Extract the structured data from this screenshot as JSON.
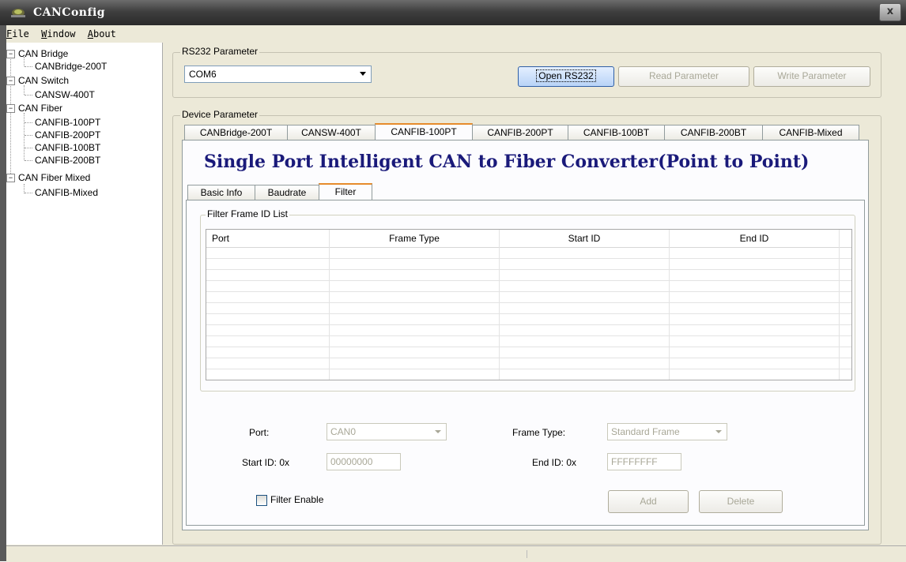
{
  "window": {
    "title": "CANConfig",
    "close_label": "x"
  },
  "menu": [
    {
      "label": "File",
      "accel": "F",
      "rest": "ile"
    },
    {
      "label": "Window",
      "accel": "W",
      "rest": "indow"
    },
    {
      "label": "About",
      "accel": "A",
      "rest": "bout"
    }
  ],
  "tree": {
    "groups": [
      {
        "label": "CAN Bridge",
        "children": [
          "CANBridge-200T"
        ]
      },
      {
        "label": "CAN Switch",
        "children": [
          "CANSW-400T"
        ]
      },
      {
        "label": "CAN Fiber",
        "children": [
          "CANFIB-100PT",
          "CANFIB-200PT",
          "CANFIB-100BT",
          "CANFIB-200BT"
        ]
      },
      {
        "label": "CAN Fiber Mixed",
        "children": [
          "CANFIB-Mixed"
        ]
      }
    ],
    "expander_symbol": "−"
  },
  "rs232": {
    "group_label": "RS232 Parameter",
    "port_value": "COM6",
    "open_button": "Open RS232",
    "read_button": "Read Parameter",
    "write_button": "Write Parameter"
  },
  "device": {
    "group_label": "Device Parameter",
    "tabs": [
      "CANBridge-200T",
      "CANSW-400T",
      "CANFIB-100PT",
      "CANFIB-200PT",
      "CANFIB-100BT",
      "CANFIB-200BT",
      "CANFIB-Mixed"
    ],
    "selected_tab": "CANFIB-100PT",
    "heading": "Single Port Intelligent CAN to Fiber Converter(Point to Point)",
    "sub_tabs": [
      "Basic Info",
      "Baudrate",
      "Filter"
    ],
    "selected_sub_tab": "Filter"
  },
  "filter": {
    "group_label": "Filter Frame ID List",
    "columns": [
      "Port",
      "Frame Type",
      "Start ID",
      "End ID"
    ],
    "rows": [],
    "port_label": "Port:",
    "port_value": "CAN0",
    "frame_type_label": "Frame Type:",
    "frame_type_value": "Standard Frame",
    "start_id_label": "Start ID: 0x",
    "start_id_value": "00000000",
    "end_id_label": "End ID: 0x",
    "end_id_value": "FFFFFFFF",
    "enable_label": "Filter Enable",
    "enable_checked": false,
    "add_button": "Add",
    "delete_button": "Delete"
  }
}
